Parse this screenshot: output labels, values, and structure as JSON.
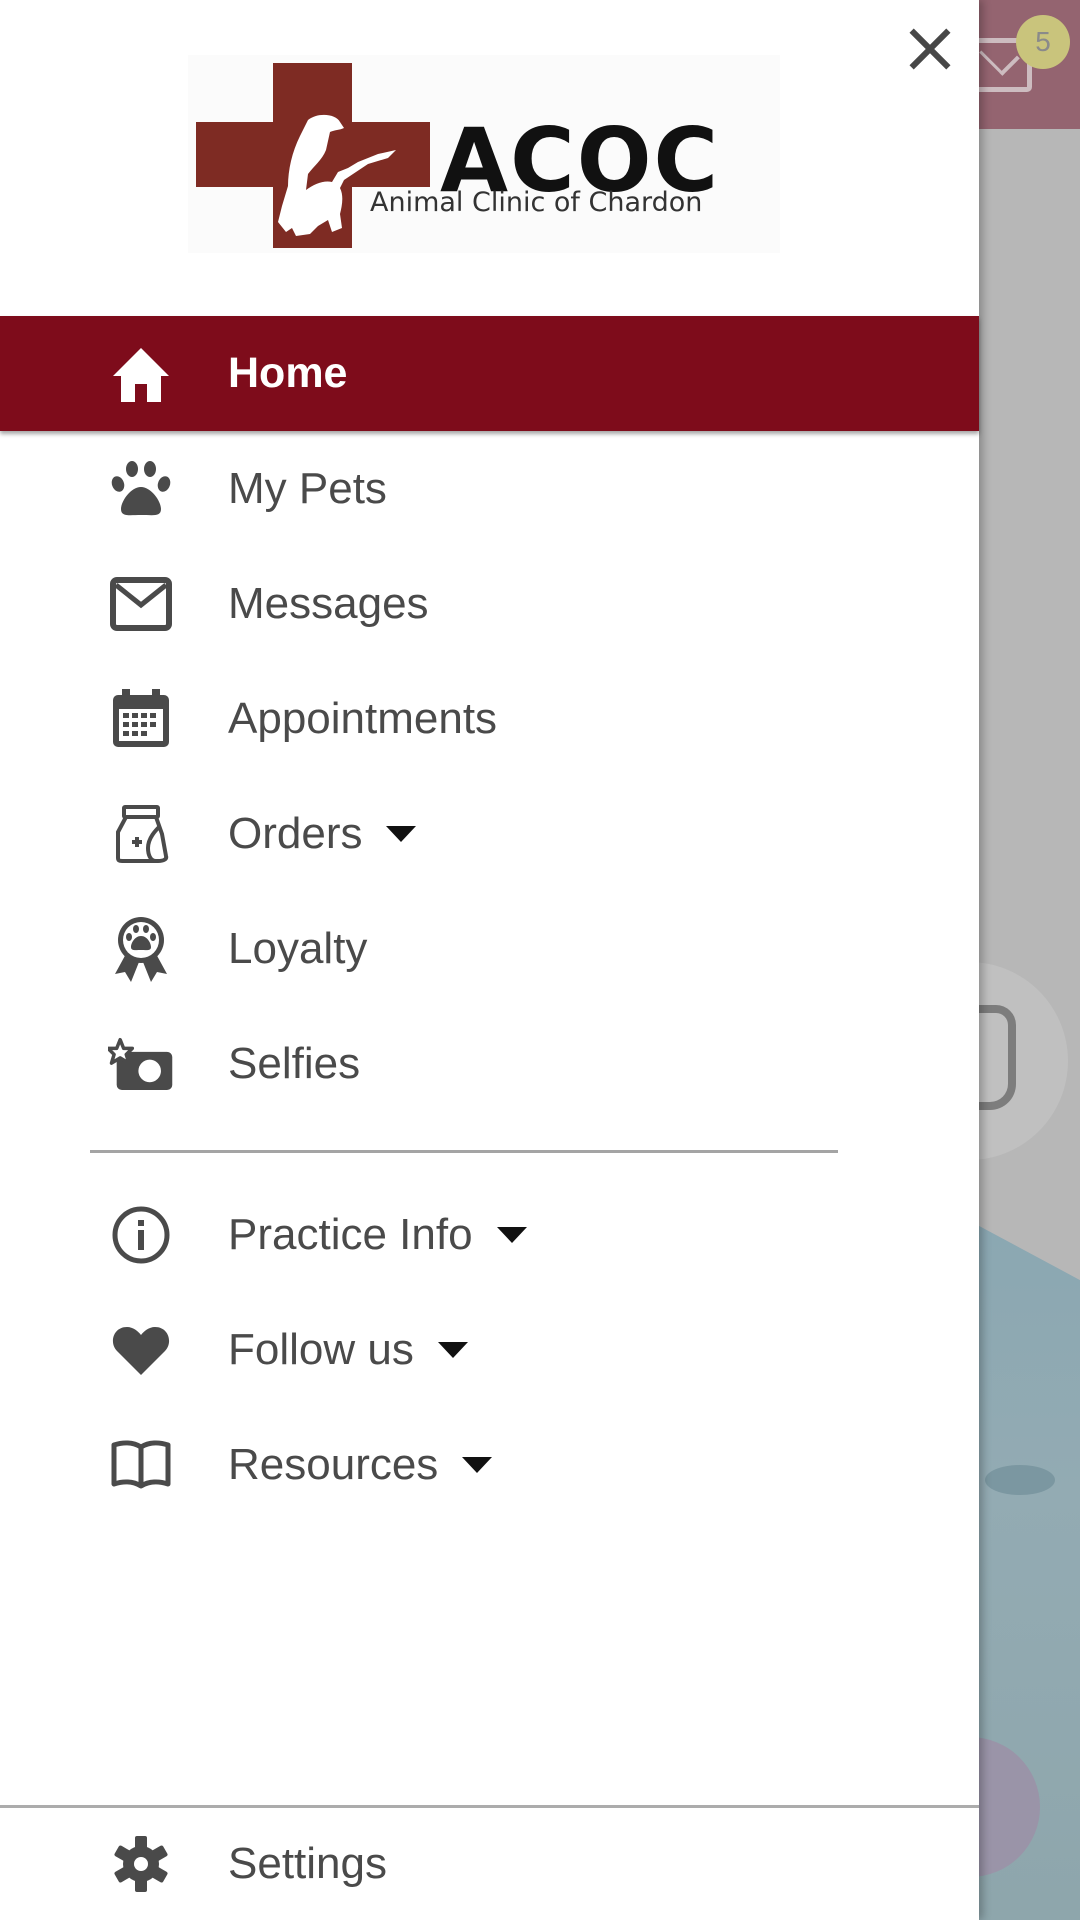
{
  "background_app": {
    "unread_badge": "5",
    "icons": [
      "mail-icon",
      "food-bag-icon"
    ]
  },
  "drawer": {
    "close_icon": "close-icon",
    "logo": {
      "name": "ACOC",
      "subtitle": "Animal Clinic of Chardon",
      "brand_color": "#7e2b23"
    },
    "active_color": "#7e0c1b",
    "primary_items": [
      {
        "label": "Home",
        "icon": "home-icon",
        "active": true,
        "has_dropdown": false
      },
      {
        "label": "My Pets",
        "icon": "paw-icon",
        "active": false,
        "has_dropdown": false
      },
      {
        "label": "Messages",
        "icon": "envelope-icon",
        "active": false,
        "has_dropdown": false
      },
      {
        "label": "Appointments",
        "icon": "calendar-icon",
        "active": false,
        "has_dropdown": false
      },
      {
        "label": "Orders",
        "icon": "food-bag-icon",
        "active": false,
        "has_dropdown": true
      },
      {
        "label": "Loyalty",
        "icon": "award-ribbon-icon",
        "active": false,
        "has_dropdown": false
      },
      {
        "label": "Selfies",
        "icon": "camera-star-icon",
        "active": false,
        "has_dropdown": false
      }
    ],
    "secondary_items": [
      {
        "label": "Practice Info",
        "icon": "info-icon",
        "has_dropdown": true
      },
      {
        "label": "Follow us",
        "icon": "heart-icon",
        "has_dropdown": true
      },
      {
        "label": "Resources",
        "icon": "book-icon",
        "has_dropdown": true
      }
    ],
    "footer": {
      "settings_label": "Settings",
      "settings_icon": "gear-icon"
    }
  }
}
